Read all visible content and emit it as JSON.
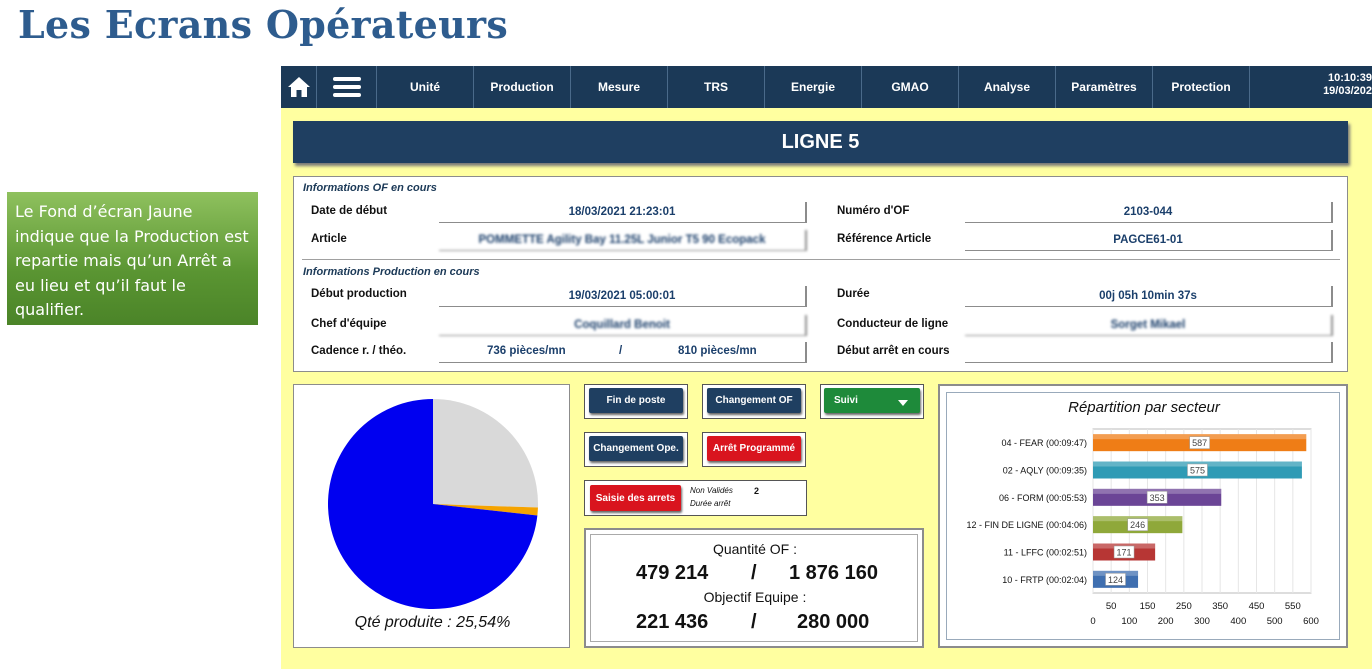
{
  "slide_title": "Les Ecrans Opérateurs",
  "callout_text": "Le Fond d’écran Jaune indique que la Production est repartie mais qu’un Arrêt a eu lieu et qu’il faut le qualifier.",
  "icons": {
    "home": "home-icon",
    "menu": "hamburger-menu-icon",
    "dropdown": "caret-down-icon"
  },
  "colors": {
    "screen_bg": "#ffffa0",
    "navbar": "#1b3957",
    "banner": "#1f3f61",
    "pie_blue": "#0000f0",
    "pie_grey": "#d9d9d9",
    "pie_orange": "#f5a300"
  },
  "nav": {
    "tabs": [
      "Unité",
      "Production",
      "Mesure",
      "TRS",
      "Energie",
      "GMAO",
      "Analyse",
      "Paramètres",
      "Protection"
    ],
    "time": "10:10:39",
    "date": "19/03/202"
  },
  "ligne_title": "LIGNE 5",
  "of_info": {
    "section_title": "Informations OF en cours",
    "date_debut_label": "Date de début",
    "date_debut_value": "18/03/2021 21:23:01",
    "numero_of_label": "Numéro d'OF",
    "numero_of_value": "2103-044",
    "article_label": "Article",
    "article_value": "POMMETTE Agility Bay 11.25L Junior T5 90 Ecopack",
    "ref_article_label": "Référence Article",
    "ref_article_value": "PAGCE61-01"
  },
  "prod_info": {
    "section_title": "Informations Production en cours",
    "debut_prod_label": "Début production",
    "debut_prod_value": "19/03/2021 05:00:01",
    "duree_label": "Durée",
    "duree_value": "00j 05h 10min 37s",
    "chef_label": "Chef d'équipe",
    "chef_value": "Coquillard Benoit",
    "conducteur_label": "Conducteur de ligne",
    "conducteur_value": "Sorget Mikael",
    "cadence_label": "Cadence r. / théo.",
    "cadence_reelle": "736 pièces/mn",
    "cadence_sep": "/",
    "cadence_theo": "810 pièces/mn",
    "debut_arret_label": "Début arrêt en cours",
    "debut_arret_value": ""
  },
  "pie": {
    "caption": "Qté produite : 25,54%",
    "produced_fraction": 0.2554,
    "slices": [
      {
        "name": "produit",
        "fraction": 0.2554,
        "color": "#d9d9d9"
      },
      {
        "name": "autre",
        "fraction": 0.012,
        "color": "#f5a300"
      },
      {
        "name": "restant",
        "fraction": 0.7326,
        "color": "#0000f0"
      }
    ]
  },
  "buttons": {
    "fin_poste": "Fin de poste",
    "changement_of": "Changement OF",
    "suivi": "Suivi",
    "changement_ope": "Changement Ope.",
    "arret_programme": "Arrêt Programmé",
    "saisie_arrets": "Saisie des arrets",
    "non_valides_label": "Non Validés",
    "non_valides_count": "2",
    "duree_arret_label": "Durée arrêt"
  },
  "quantite": {
    "of_label": "Quantité OF :",
    "of_done": "479 214",
    "of_sep": "/",
    "of_total": "1 876 160",
    "objectif_label": "Objectif Equipe :",
    "obj_done": "221 436",
    "obj_sep": "/",
    "obj_total": "280 000"
  },
  "chart_data": {
    "type": "bar",
    "orientation": "horizontal",
    "title": "Répartition par secteur",
    "categories": [
      "04 - FEAR (00:09:47)",
      "02 - AQLY (00:09:35)",
      "06 - FORM (00:05:53)",
      "12 - FIN DE LIGNE (00:04:06)",
      "11 - LFFC (00:02:51)",
      "10 - FRTP (00:02:04)"
    ],
    "values": [
      587,
      575,
      353,
      246,
      171,
      124
    ],
    "data_labels": [
      "587",
      "575",
      "353",
      "246",
      "171",
      "124"
    ],
    "bar_colors": [
      "#ef7d16",
      "#2f9bb5",
      "#6b4596",
      "#8fa83a",
      "#b73634",
      "#3f6fb0"
    ],
    "xlim": [
      0,
      600
    ],
    "x_ticks_upper": [
      "50",
      "150",
      "250",
      "350",
      "450",
      "550"
    ],
    "x_ticks_lower": [
      "0",
      "100",
      "200",
      "300",
      "400",
      "500",
      "600"
    ],
    "grid": true
  }
}
